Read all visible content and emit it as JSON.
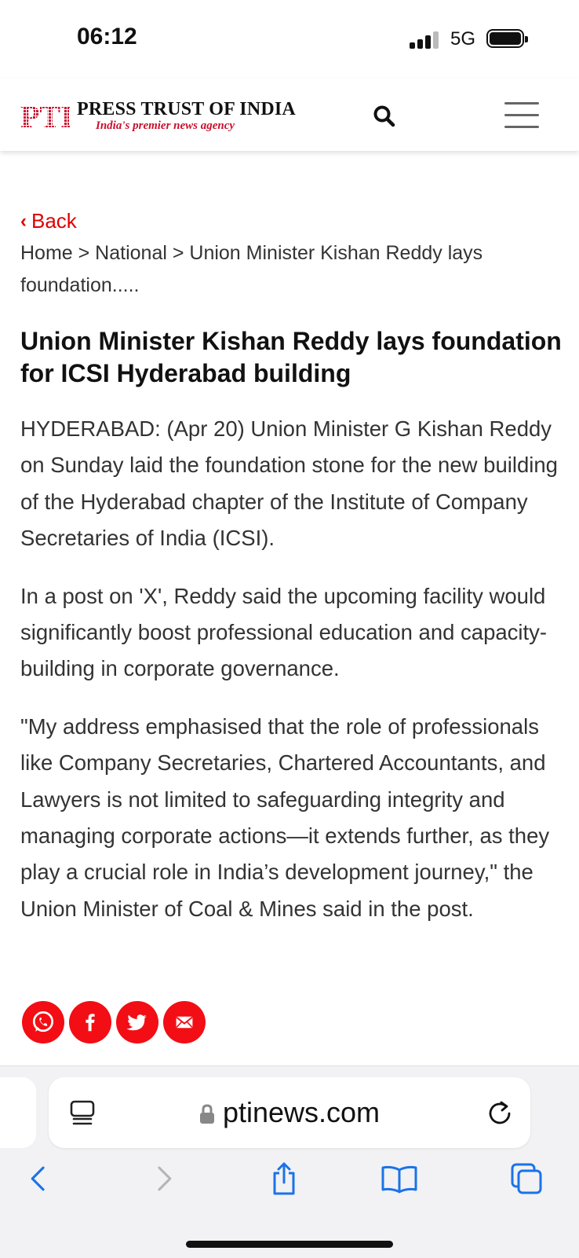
{
  "status_bar": {
    "time": "06:12",
    "network": "5G"
  },
  "header": {
    "logo_name": "PRESS TRUST OF INDIA",
    "logo_mark_text": "PTI",
    "logo_tagline": "India's premier news agency",
    "brand_color": "#c8102e",
    "search_icon": "search-icon",
    "menu_icon": "hamburger-icon"
  },
  "nav": {
    "back_label": "Back",
    "breadcrumb": "Home > National > Union Minister Kishan Reddy lays foundation....."
  },
  "article": {
    "headline": "Union Minister Kishan Reddy lays foundation for ICSI Hyderabad building",
    "paragraphs": [
      "HYDERABAD: (Apr 20) Union Minister G Kishan Reddy on Sunday laid the foundation stone for the new building of the Hyderabad chapter of the Institute of Company Secretaries of India (ICSI).",
      "In a post on 'X', Reddy said the upcoming facility would significantly boost professional education and capacity-building in corporate governance.",
      "\"My address emphasised that the role of professionals like Company Secretaries, Chartered Accountants, and Lawyers is not limited to safeguarding integrity and managing corporate actions—it extends further, as they play a crucial role in India’s development journey,\" the Union Minister of Coal & Mines said in the post."
    ]
  },
  "share": {
    "color": "#f20e14",
    "buttons": [
      "whatsapp-icon",
      "facebook-icon",
      "twitter-icon",
      "email-icon"
    ]
  },
  "browser": {
    "url": "ptinews.com",
    "icons": [
      "reader-icon",
      "lock-icon",
      "reload-icon",
      "back-arrow-icon",
      "forward-arrow-icon",
      "share-icon",
      "bookmarks-icon",
      "tabs-icon"
    ],
    "accent": "#1a73e8"
  }
}
